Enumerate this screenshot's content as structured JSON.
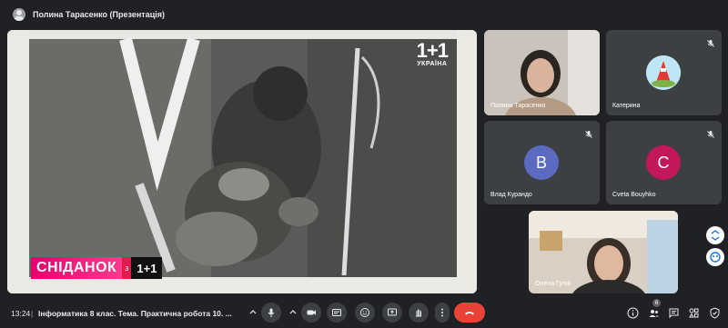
{
  "topbar": {
    "presenter_title": "Полина Тарасенко (Презентація)"
  },
  "presentation": {
    "logo_number": "1+1",
    "logo_sub": "УКРАЇНА",
    "banner_show": "СНІДАНОК",
    "banner_with": "з",
    "banner_channel": "1+1"
  },
  "participants": [
    {
      "name": "Полина Тарасенко",
      "type": "video",
      "muted": false
    },
    {
      "name": "Катерина",
      "type": "avatar-image",
      "muted": true
    },
    {
      "name": "Влад Курандо",
      "type": "initial",
      "initial": "В",
      "color": "#5c6bc0",
      "muted": true
    },
    {
      "name": "Cveta Bouyhko",
      "type": "initial",
      "initial": "C",
      "color": "#c2185b",
      "muted": true
    },
    {
      "name": "Олена Гулій",
      "type": "video",
      "muted": false
    }
  ],
  "bottombar": {
    "time": "13:24",
    "separator": "|",
    "meeting_title": "Інформатика 8 клас. Тема. Практична робота 10. ...",
    "people_count": "6"
  },
  "colors": {
    "end_call": "#ea4335",
    "control_bg": "#3c4043",
    "background": "#202124"
  }
}
